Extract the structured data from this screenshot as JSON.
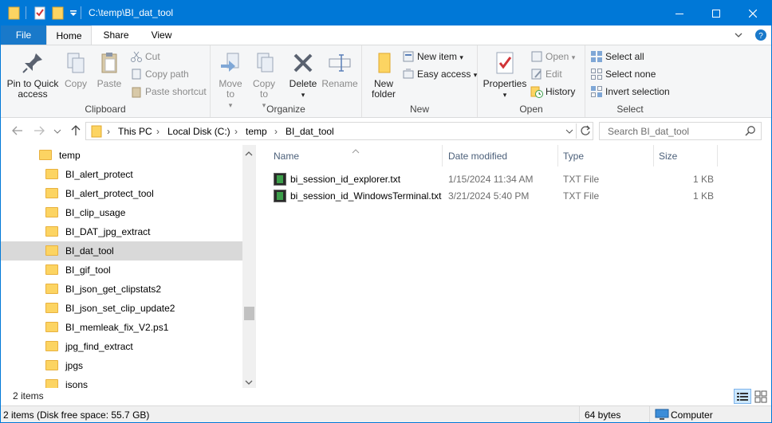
{
  "window": {
    "title": "C:\\temp\\BI_dat_tool"
  },
  "tabs": {
    "file": "File",
    "home": "Home",
    "share": "Share",
    "view": "View"
  },
  "ribbon": {
    "clipboard": {
      "label": "Clipboard",
      "pin": "Pin to Quick access",
      "copy": "Copy",
      "paste": "Paste",
      "cut": "Cut",
      "copy_path": "Copy path",
      "paste_shortcut": "Paste shortcut"
    },
    "organize": {
      "label": "Organize",
      "move_to": "Move to",
      "copy_to": "Copy to",
      "delete": "Delete",
      "rename": "Rename"
    },
    "new": {
      "label": "New",
      "new_folder": "New folder",
      "new_item": "New item",
      "easy_access": "Easy access"
    },
    "open": {
      "label": "Open",
      "properties": "Properties",
      "open": "Open",
      "edit": "Edit",
      "history": "History"
    },
    "select": {
      "label": "Select",
      "select_all": "Select all",
      "select_none": "Select none",
      "invert": "Invert selection"
    }
  },
  "address": {
    "crumbs": [
      "This PC",
      "Local Disk (C:)",
      "temp",
      "BI_dat_tool"
    ],
    "search_placeholder": "Search BI_dat_tool"
  },
  "nav": {
    "items": [
      {
        "label": "temp",
        "level": 0,
        "selected": false
      },
      {
        "label": "BI_alert_protect",
        "level": 1,
        "selected": false
      },
      {
        "label": "BI_alert_protect_tool",
        "level": 1,
        "selected": false
      },
      {
        "label": "BI_clip_usage",
        "level": 1,
        "selected": false
      },
      {
        "label": "BI_DAT_jpg_extract",
        "level": 1,
        "selected": false
      },
      {
        "label": "BI_dat_tool",
        "level": 1,
        "selected": true
      },
      {
        "label": "BI_gif_tool",
        "level": 1,
        "selected": false
      },
      {
        "label": "BI_json_get_clipstats2",
        "level": 1,
        "selected": false
      },
      {
        "label": "BI_json_set_clip_update2",
        "level": 1,
        "selected": false
      },
      {
        "label": "BI_memleak_fix_V2.ps1",
        "level": 1,
        "selected": false
      },
      {
        "label": "jpg_find_extract",
        "level": 1,
        "selected": false
      },
      {
        "label": "jpgs",
        "level": 1,
        "selected": false
      },
      {
        "label": "jsons",
        "level": 1,
        "selected": false
      }
    ]
  },
  "columns": {
    "name": "Name",
    "date": "Date modified",
    "type": "Type",
    "size": "Size"
  },
  "files": [
    {
      "name": "bi_session_id_explorer.txt",
      "date": "1/15/2024 11:34 AM",
      "type": "TXT File",
      "size": "1 KB"
    },
    {
      "name": "bi_session_id_WindowsTerminal.txt",
      "date": "3/21/2024 5:40 PM",
      "type": "TXT File",
      "size": "1 KB"
    }
  ],
  "status": {
    "items": "2 items",
    "disk": "2 items (Disk free space: 55.7 GB)",
    "bytes": "64 bytes",
    "location": "Computer"
  }
}
